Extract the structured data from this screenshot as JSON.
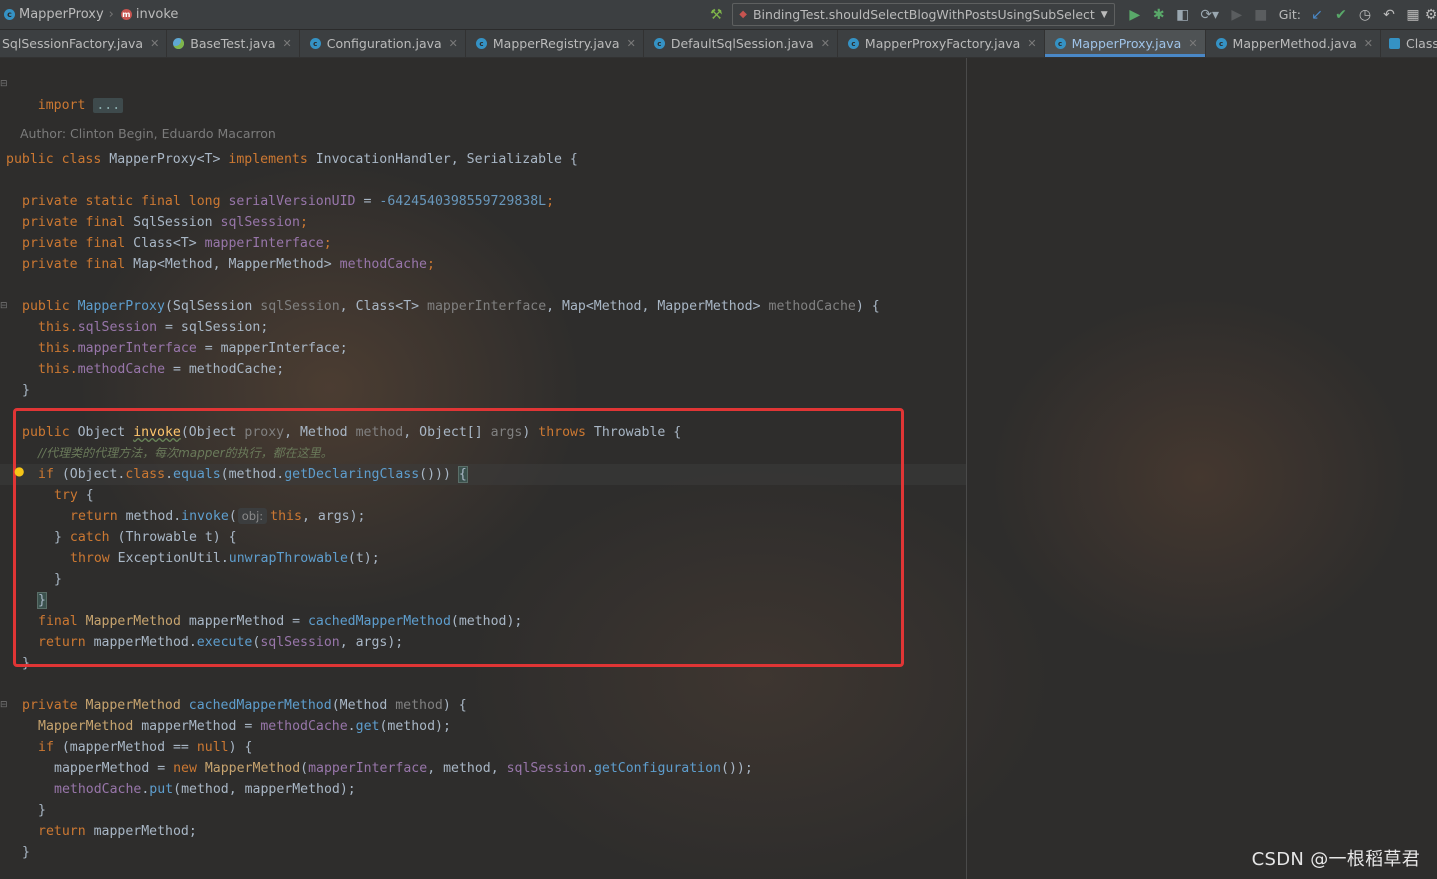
{
  "breadcrumb": {
    "class_name": "MapperProxy",
    "method_name": "invoke"
  },
  "toolbar": {
    "run_config": "BindingTest.shouldSelectBlogWithPostsUsingSubSelect",
    "git_label": "Git:"
  },
  "tabs": [
    {
      "label": "SqlSessionFactory.java"
    },
    {
      "label": "BaseTest.java"
    },
    {
      "label": "Configuration.java"
    },
    {
      "label": "MapperRegistry.java"
    },
    {
      "label": "DefaultSqlSession.java"
    },
    {
      "label": "MapperProxyFactory.java"
    },
    {
      "label": "MapperProxy.java"
    },
    {
      "label": "MapperMethod.java"
    },
    {
      "label": "Class.java"
    }
  ],
  "active_tab": "MapperProxy.java",
  "code": {
    "import_kw": "import",
    "import_folded": "...",
    "author": "Author: Clinton Begin, Eduardo Macarron",
    "class_decl": {
      "public": "public",
      "class_kw": "class",
      "name": "MapperProxy",
      "generic": "<T>",
      "implements": "implements",
      "iface1": "InvocationHandler",
      "comma": ",",
      "iface2": "Serializable",
      "brace": "{"
    },
    "field1": {
      "mods": "private static final",
      "type": "long",
      "name": "serialVersionUID",
      "eq": "=",
      "value": "-6424540398559729838L",
      "semi": ";"
    },
    "field2": {
      "mods": "private final",
      "type": "SqlSession",
      "name": "sqlSession",
      "semi": ";"
    },
    "field3": {
      "mods": "private final",
      "type": "Class<T>",
      "name": "mapperInterface",
      "semi": ";"
    },
    "field4": {
      "mods": "private final",
      "type": "Map<Method, MapperMethod>",
      "name": "methodCache",
      "semi": ";"
    },
    "ctor": {
      "public": "public",
      "name": "MapperProxy",
      "open": "(",
      "p1type": "SqlSession",
      "p1": "sqlSession",
      "c1": ",",
      "p2type": "Class<T>",
      "p2": "mapperInterface",
      "c2": ",",
      "p3type": "Map<Method, MapperMethod>",
      "p3": "methodCache",
      "close": ") {"
    },
    "ctor_b1": {
      "this": "this.",
      "field": "sqlSession",
      "rest": " = sqlSession;"
    },
    "ctor_b2": {
      "this": "this.",
      "field": "mapperInterface",
      "rest": " = mapperInterface;"
    },
    "ctor_b3": {
      "this": "this.",
      "field": "methodCache",
      "rest": " = methodCache;"
    },
    "close_brace": "}",
    "invoke_decl": {
      "public": "public",
      "ret": "Object",
      "name": "invoke",
      "open": "(",
      "p1type": "Object",
      "p1": "proxy",
      "c1": ",",
      "p2type": "Method",
      "p2": "method",
      "c2": ",",
      "p3type": "Object[]",
      "p3": "args",
      "close": ")",
      "throws": "throws",
      "exc": "Throwable",
      "brace": "{"
    },
    "comment": "//代理类的代理方法，每次mapper的执行，都在这里。",
    "if_line": {
      "if": "if",
      "open": " (Object.",
      "class_kw": "class",
      "dot": ".",
      "equals": "equals",
      "p1": "(method.",
      "getDecl": "getDeclaringClass",
      "p2": "())) ",
      "brace": "{"
    },
    "try_line": {
      "try": "try",
      "brace": " {"
    },
    "return_invoke": {
      "return": "return",
      "pre": " method.",
      "invoke": "invoke",
      "open": "(",
      "hint": "obj:",
      "this": "this",
      "rest": ", args);"
    },
    "catch_line": {
      "pre": "} ",
      "catch": "catch",
      "mid": " (Throwable t) {"
    },
    "throw_line": {
      "throw": "throw",
      "pre": " ExceptionUtil.",
      "unwrap": "unwrapThrowable",
      "rest": "(t);"
    },
    "final_line": {
      "final": "final",
      "type": " MapperMethod",
      "pre": " mapperMethod = ",
      "call": "cachedMapperMethod",
      "rest": "(method);"
    },
    "return_exec": {
      "return": "return",
      "pre": " mapperMethod.",
      "exec": "execute",
      "open": "(",
      "field": "sqlSession",
      "rest": ", args);"
    },
    "cached_decl": {
      "private": "private",
      "type": "MapperMethod",
      "name": "cachedMapperMethod",
      "open": "(",
      "ptype": "Method",
      "p": "method",
      "close": ") {"
    },
    "cached_b1": {
      "type": "MapperMethod",
      "pre": " mapperMethod = ",
      "field": "methodCache",
      "dot": ".",
      "get": "get",
      "rest": "(method);"
    },
    "cached_b2": {
      "if": "if",
      "rest": " (mapperMethod == ",
      "null": "null",
      "close": ") {"
    },
    "cached_b3": {
      "pre": "mapperMethod = ",
      "new": "new",
      "type": " MapperMethod",
      "open": "(",
      "f1": "mapperInterface",
      "mid": ", method, ",
      "f2": "sqlSession",
      "dot": ".",
      "getConf": "getConfiguration",
      "rest": "());"
    },
    "cached_b4": {
      "field": "methodCache",
      "dot": ".",
      "put": "put",
      "rest": "(method, mapperMethod);"
    },
    "cached_b6": {
      "return": "return",
      "rest": " mapperMethod;"
    }
  },
  "watermark": "CSDN @一根稻草君"
}
